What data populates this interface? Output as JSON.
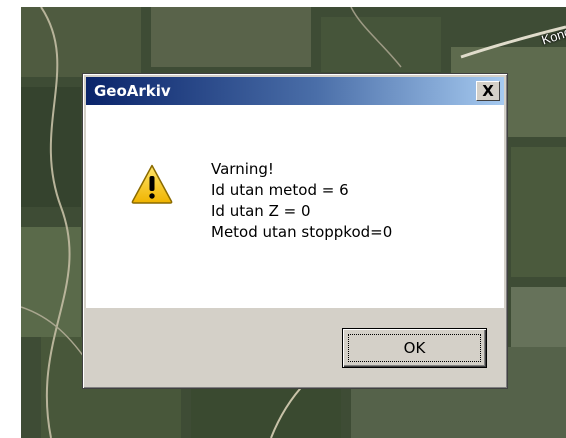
{
  "background": {
    "map_label": "Kong"
  },
  "dialog": {
    "title": "GeoArkiv",
    "close_symbol": "X",
    "icon": "warning-icon",
    "message_lines": [
      "Varning!",
      "Id utan metod = 6",
      "Id utan Z = 0",
      "Metod utan stoppkod=0"
    ],
    "ok_label": "OK"
  },
  "colors": {
    "titlebar_start": "#0a246a",
    "titlebar_end": "#a6caf0",
    "dialog_face": "#d4d0c8",
    "warning_yellow": "#f5c400"
  }
}
